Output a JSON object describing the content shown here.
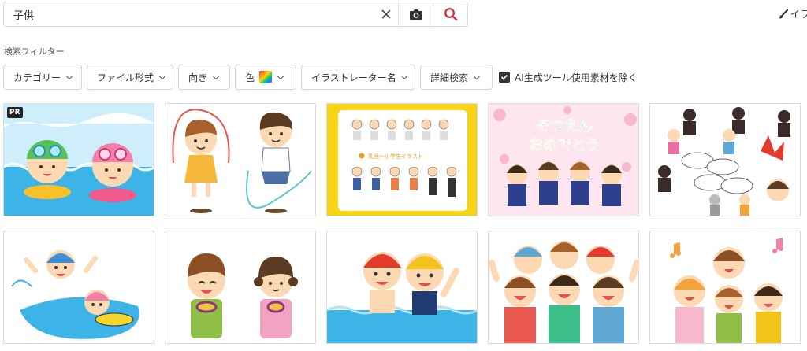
{
  "search": {
    "value": "子供"
  },
  "header": {
    "right_link": "イラ"
  },
  "filters": {
    "title": "検索フィルター",
    "chips": [
      {
        "label": "カテゴリー"
      },
      {
        "label": "ファイル形式"
      },
      {
        "label": "向き"
      },
      {
        "label": "色"
      },
      {
        "label": "イラストレーター名"
      },
      {
        "label": "詳細検索"
      }
    ],
    "ai_exclude": {
      "label": "AI生成ツール使用素材を除く",
      "checked": true
    }
  },
  "results": {
    "badge": "PR",
    "tiles": [
      {
        "icon": "kids-swimming-illustration"
      },
      {
        "icon": "kids-jump-rope-illustration"
      },
      {
        "icon": "child-age-chart-illustration",
        "caption": "乳児〜小学生イラスト"
      },
      {
        "icon": "kindergarten-graduation-illustration",
        "title_line1": "そつえん",
        "title_line2": "おめでとう"
      },
      {
        "icon": "kids-game-manga-illustration"
      },
      {
        "icon": "kids-pool-float-illustration"
      },
      {
        "icon": "kids-eating-sweet-potato-illustration"
      },
      {
        "icon": "kids-swim-caps-illustration"
      },
      {
        "icon": "group-of-kids-cheering-illustration"
      },
      {
        "icon": "kids-singing-illustration"
      }
    ]
  },
  "colors": {
    "accent": "#d6334b",
    "chip_border": "#d5d5d5"
  }
}
